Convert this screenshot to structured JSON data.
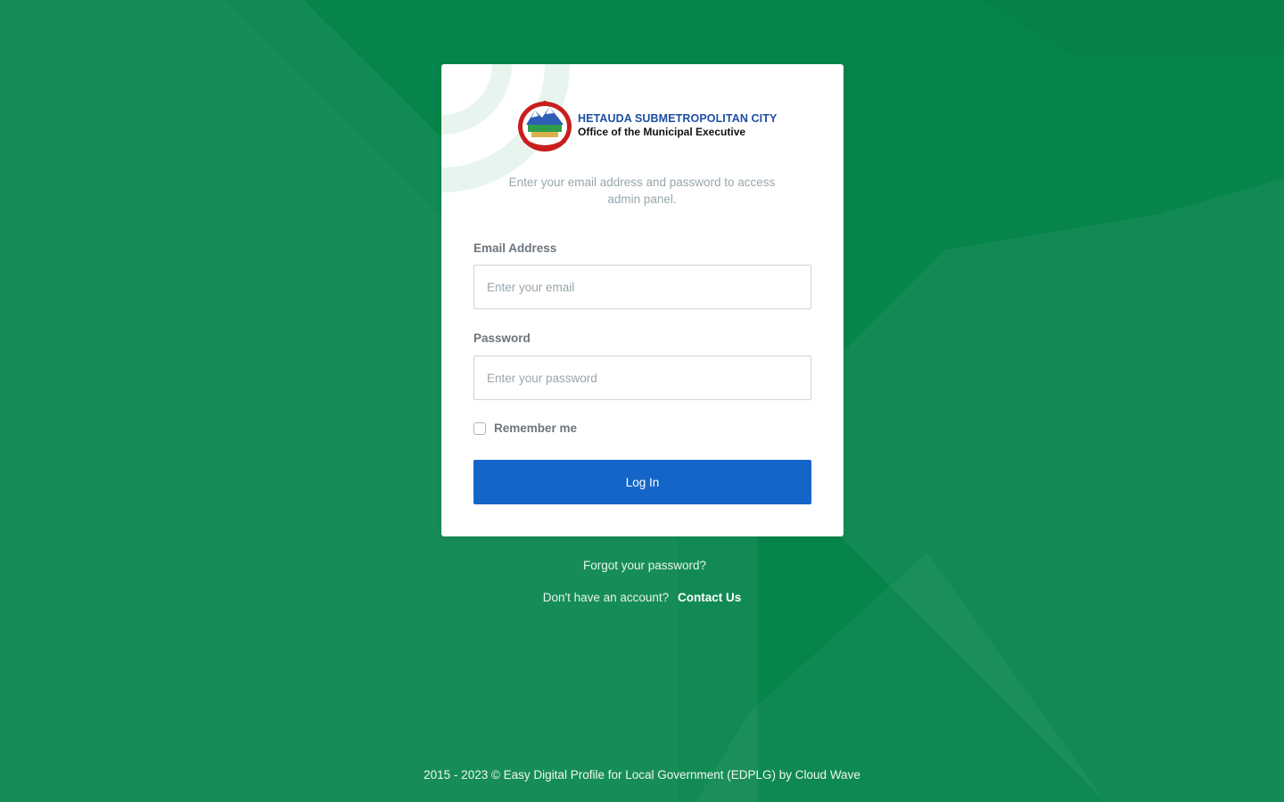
{
  "colors": {
    "background": "#0a8449",
    "card": "#ffffff",
    "primary_button": "#1565c8",
    "logo_blue": "#1d4fa3"
  },
  "logo": {
    "icon": "nepal-emblem-icon",
    "line1": "HETAUDA SUBMETROPOLITAN CITY",
    "line2": "Office of the Municipal Executive"
  },
  "login_form": {
    "subtitle": "Enter your email address and password to access admin panel.",
    "email": {
      "label": "Email Address",
      "placeholder": "Enter your email",
      "value": ""
    },
    "password": {
      "label": "Password",
      "placeholder": "Enter your password",
      "value": ""
    },
    "remember": {
      "label": "Remember me",
      "checked": false
    },
    "submit_label": "Log In"
  },
  "links": {
    "forgot_password": "Forgot your password?",
    "no_account": "Don't have an account?",
    "contact_us": "Contact Us"
  },
  "footer": {
    "text": "2015 - 2023 © Easy Digital Profile for Local Government (EDPLG) by Cloud Wave"
  }
}
